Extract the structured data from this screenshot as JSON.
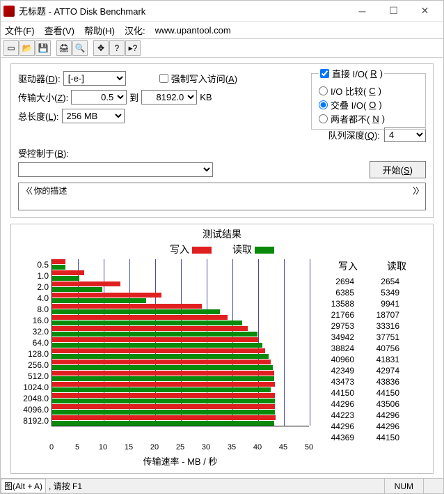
{
  "title": "无标题 - ATTO Disk Benchmark",
  "menu": {
    "file": "文件(F)",
    "view": "查看(V)",
    "help": "帮助(H)",
    "han": "汉化:",
    "url": "www.upantool.com"
  },
  "labels": {
    "drive": "驱动器(D):",
    "drive_val": "[-e-]",
    "xfer": "传输大小(Z):",
    "xfer_from": "0.5",
    "to": "到",
    "xfer_to": "8192.0",
    "kb": "KB",
    "len": "总长度(L):",
    "len_val": "256 MB",
    "force": "强制写入访问(A)",
    "direct": "直接 I/O(R)",
    "io_cmp": "I/O 比较(C)",
    "overlap": "交叠 I/O(O)",
    "neither": "两者都不(N)",
    "queue": "队列深度(Q):",
    "queue_val": "4",
    "ctrl": "受控制于(B):",
    "start": "开始(S)",
    "desc_pre": "〈〈",
    "desc": "你的描述",
    "desc_post": "〉〉",
    "results": "测试结果",
    "write": "写入",
    "read": "读取",
    "xaxis": "传输速率 - MB / 秒",
    "status_left": "图(Alt + A)",
    "status_mid": ", 请按 F1",
    "status_num": "NUM"
  },
  "chart_data": {
    "type": "bar",
    "title": "测试结果",
    "xlabel": "传输速率 - MB / 秒",
    "ylabel": "",
    "xlim": [
      0,
      50
    ],
    "xticks": [
      0,
      5,
      10,
      15,
      20,
      25,
      30,
      35,
      40,
      45,
      50
    ],
    "categories": [
      "0.5",
      "1.0",
      "2.0",
      "4.0",
      "8.0",
      "16.0",
      "32.0",
      "64.0",
      "128.0",
      "256.0",
      "512.0",
      "1024.0",
      "2048.0",
      "4096.0",
      "8192.0"
    ],
    "series": [
      {
        "name": "写入",
        "color": "#e02020",
        "values_kb": [
          2694,
          6385,
          13588,
          21766,
          29753,
          34942,
          38824,
          40960,
          42349,
          43473,
          44150,
          44296,
          44223,
          44296,
          44369
        ],
        "values_mb": [
          2.63,
          6.24,
          13.27,
          21.26,
          29.06,
          34.12,
          37.91,
          40.0,
          41.36,
          42.45,
          43.12,
          43.26,
          43.19,
          43.26,
          43.33
        ]
      },
      {
        "name": "读取",
        "color": "#0a8a0a",
        "values_kb": [
          2654,
          5349,
          9941,
          18707,
          33316,
          37751,
          40756,
          41831,
          42974,
          43836,
          44150,
          43506,
          44296,
          44296,
          44150
        ],
        "values_mb": [
          2.59,
          5.22,
          9.71,
          18.27,
          32.54,
          36.87,
          39.8,
          40.85,
          41.97,
          42.81,
          43.12,
          42.49,
          43.26,
          43.26,
          43.12
        ]
      }
    ]
  }
}
